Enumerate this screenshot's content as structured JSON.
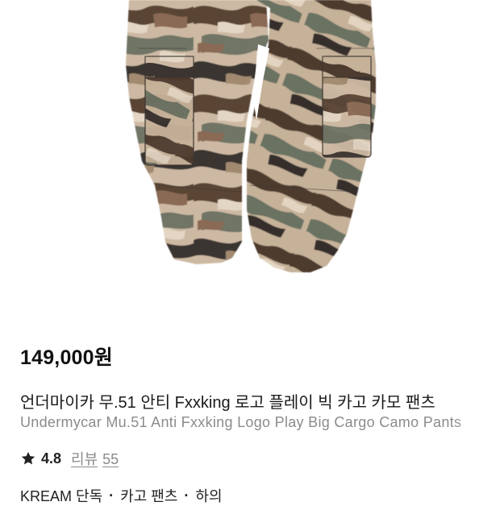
{
  "product": {
    "image_icon": "camo-cargo-pants-photo",
    "price": "149,000원",
    "title_ko": "언더마이카 무.51 안티 Fxxking 로고 플레이 빅 카고 카모 팬츠",
    "title_en": "Undermycar Mu.51 Anti Fxxking Logo Play Big Cargo Camo Pants",
    "rating": "4.8",
    "review_label": "리뷰",
    "review_count": "55",
    "tags": [
      "KREAM 단독",
      "카고 팬츠",
      "하의"
    ],
    "tag_separator": "·"
  },
  "colors": {
    "text": "#111111",
    "muted": "#8b8b8b",
    "star": "#222222"
  }
}
